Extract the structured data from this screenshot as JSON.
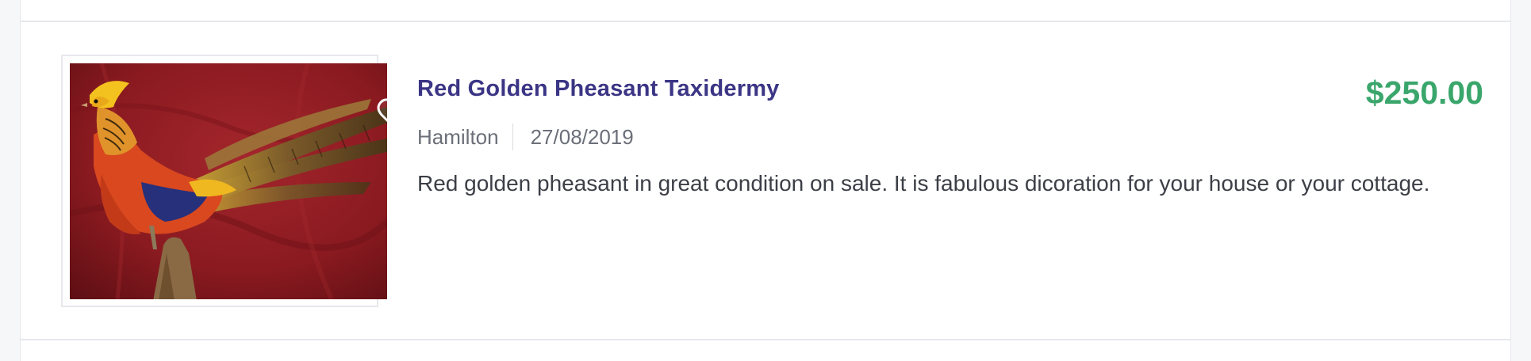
{
  "listing": {
    "title": "Red Golden Pheasant Taxidermy",
    "price": "$250.00",
    "location": "Hamilton",
    "date": "27/08/2019",
    "description": "Red golden pheasant in great condition on sale. It is fabulous dicoration for your house or your cottage.",
    "favorite_icon": "heart-outline-icon"
  },
  "colors": {
    "title": "#3b3585",
    "price": "#3aa66b",
    "meta": "#6b6f78",
    "description": "#3c3f46",
    "photo_background": "#8e1c22"
  }
}
